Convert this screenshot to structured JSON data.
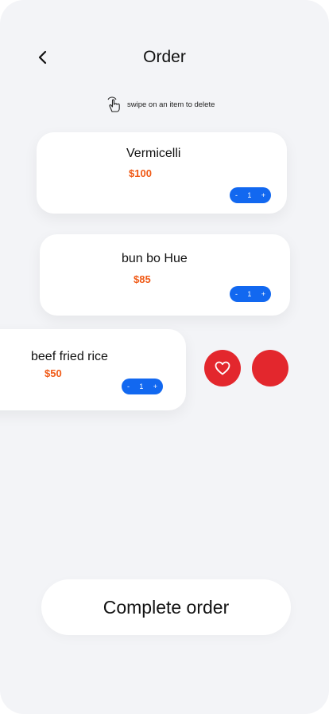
{
  "header": {
    "title": "Order"
  },
  "hint": {
    "text": "swipe on an item to delete"
  },
  "items": [
    {
      "name": "Vermicelli",
      "price": "$100",
      "minus": "-",
      "qty": "1",
      "plus": "+"
    },
    {
      "name": "bun bo Hue",
      "price": "$85",
      "minus": "-",
      "qty": "1",
      "plus": "+"
    },
    {
      "name": "beef fried rice",
      "price": "$50",
      "minus": "-",
      "qty": "1",
      "plus": "+"
    }
  ],
  "icons": {
    "back": "chevron-left-icon",
    "hint": "swipe-hand-icon",
    "favorite": "heart-icon"
  },
  "colors": {
    "accent": "#1268f0",
    "price": "#f05a16",
    "action": "#e3272d",
    "background": "#f3f4f7"
  },
  "footer": {
    "complete_label": "Complete order"
  }
}
